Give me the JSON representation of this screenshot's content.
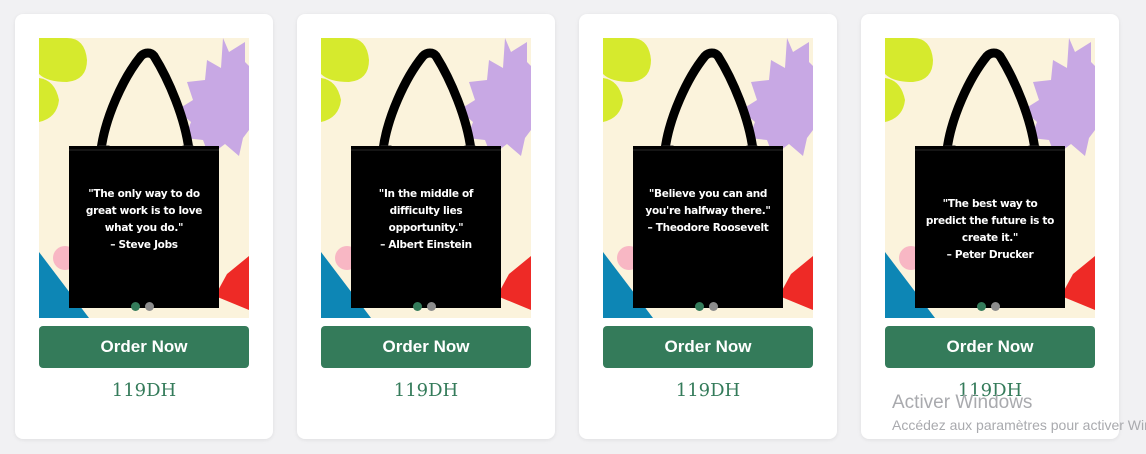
{
  "products": [
    {
      "quote_lines": [
        "\"The only way to do",
        "great work is to love",
        "what you do.\"",
        "– Steve Jobs"
      ],
      "button_label": "Order Now",
      "price": "119DH"
    },
    {
      "quote_lines": [
        "\"In the middle of",
        "difficulty lies",
        "opportunity.\"",
        "– Albert Einstein"
      ],
      "button_label": "Order Now",
      "price": "119DH"
    },
    {
      "quote_lines": [
        "\"Believe you can and",
        "you're halfway there.\"",
        "– Theodore Roosevelt"
      ],
      "button_label": "Order Now",
      "price": "119DH"
    },
    {
      "quote_lines": [
        "\"The best way to",
        "predict the future is to",
        "create it.\"",
        "– Peter Drucker"
      ],
      "button_label": "Order Now",
      "price": "119DH"
    }
  ],
  "carousel": {
    "total_slides": 2,
    "active_slide": 1
  },
  "watermark": {
    "title": "Activer Windows",
    "subtitle": "Accédez aux paramètres pour activer Windows."
  },
  "colors": {
    "accent_green": "#347b5a",
    "bag": "#000000",
    "image_bg": "#fbf3dc",
    "shape_lime": "#d6ea2d",
    "shape_lavender": "#c8a8e4",
    "shape_blue": "#0d86b5",
    "shape_red": "#ee2a26",
    "shape_pink": "#f8b7c4",
    "dot_active": "#347b5a",
    "dot_inactive": "#8c8c8c"
  },
  "icons": {
    "active_dot": "carousel-dot-active-icon",
    "inactive_dot": "carousel-dot-inactive-icon"
  }
}
